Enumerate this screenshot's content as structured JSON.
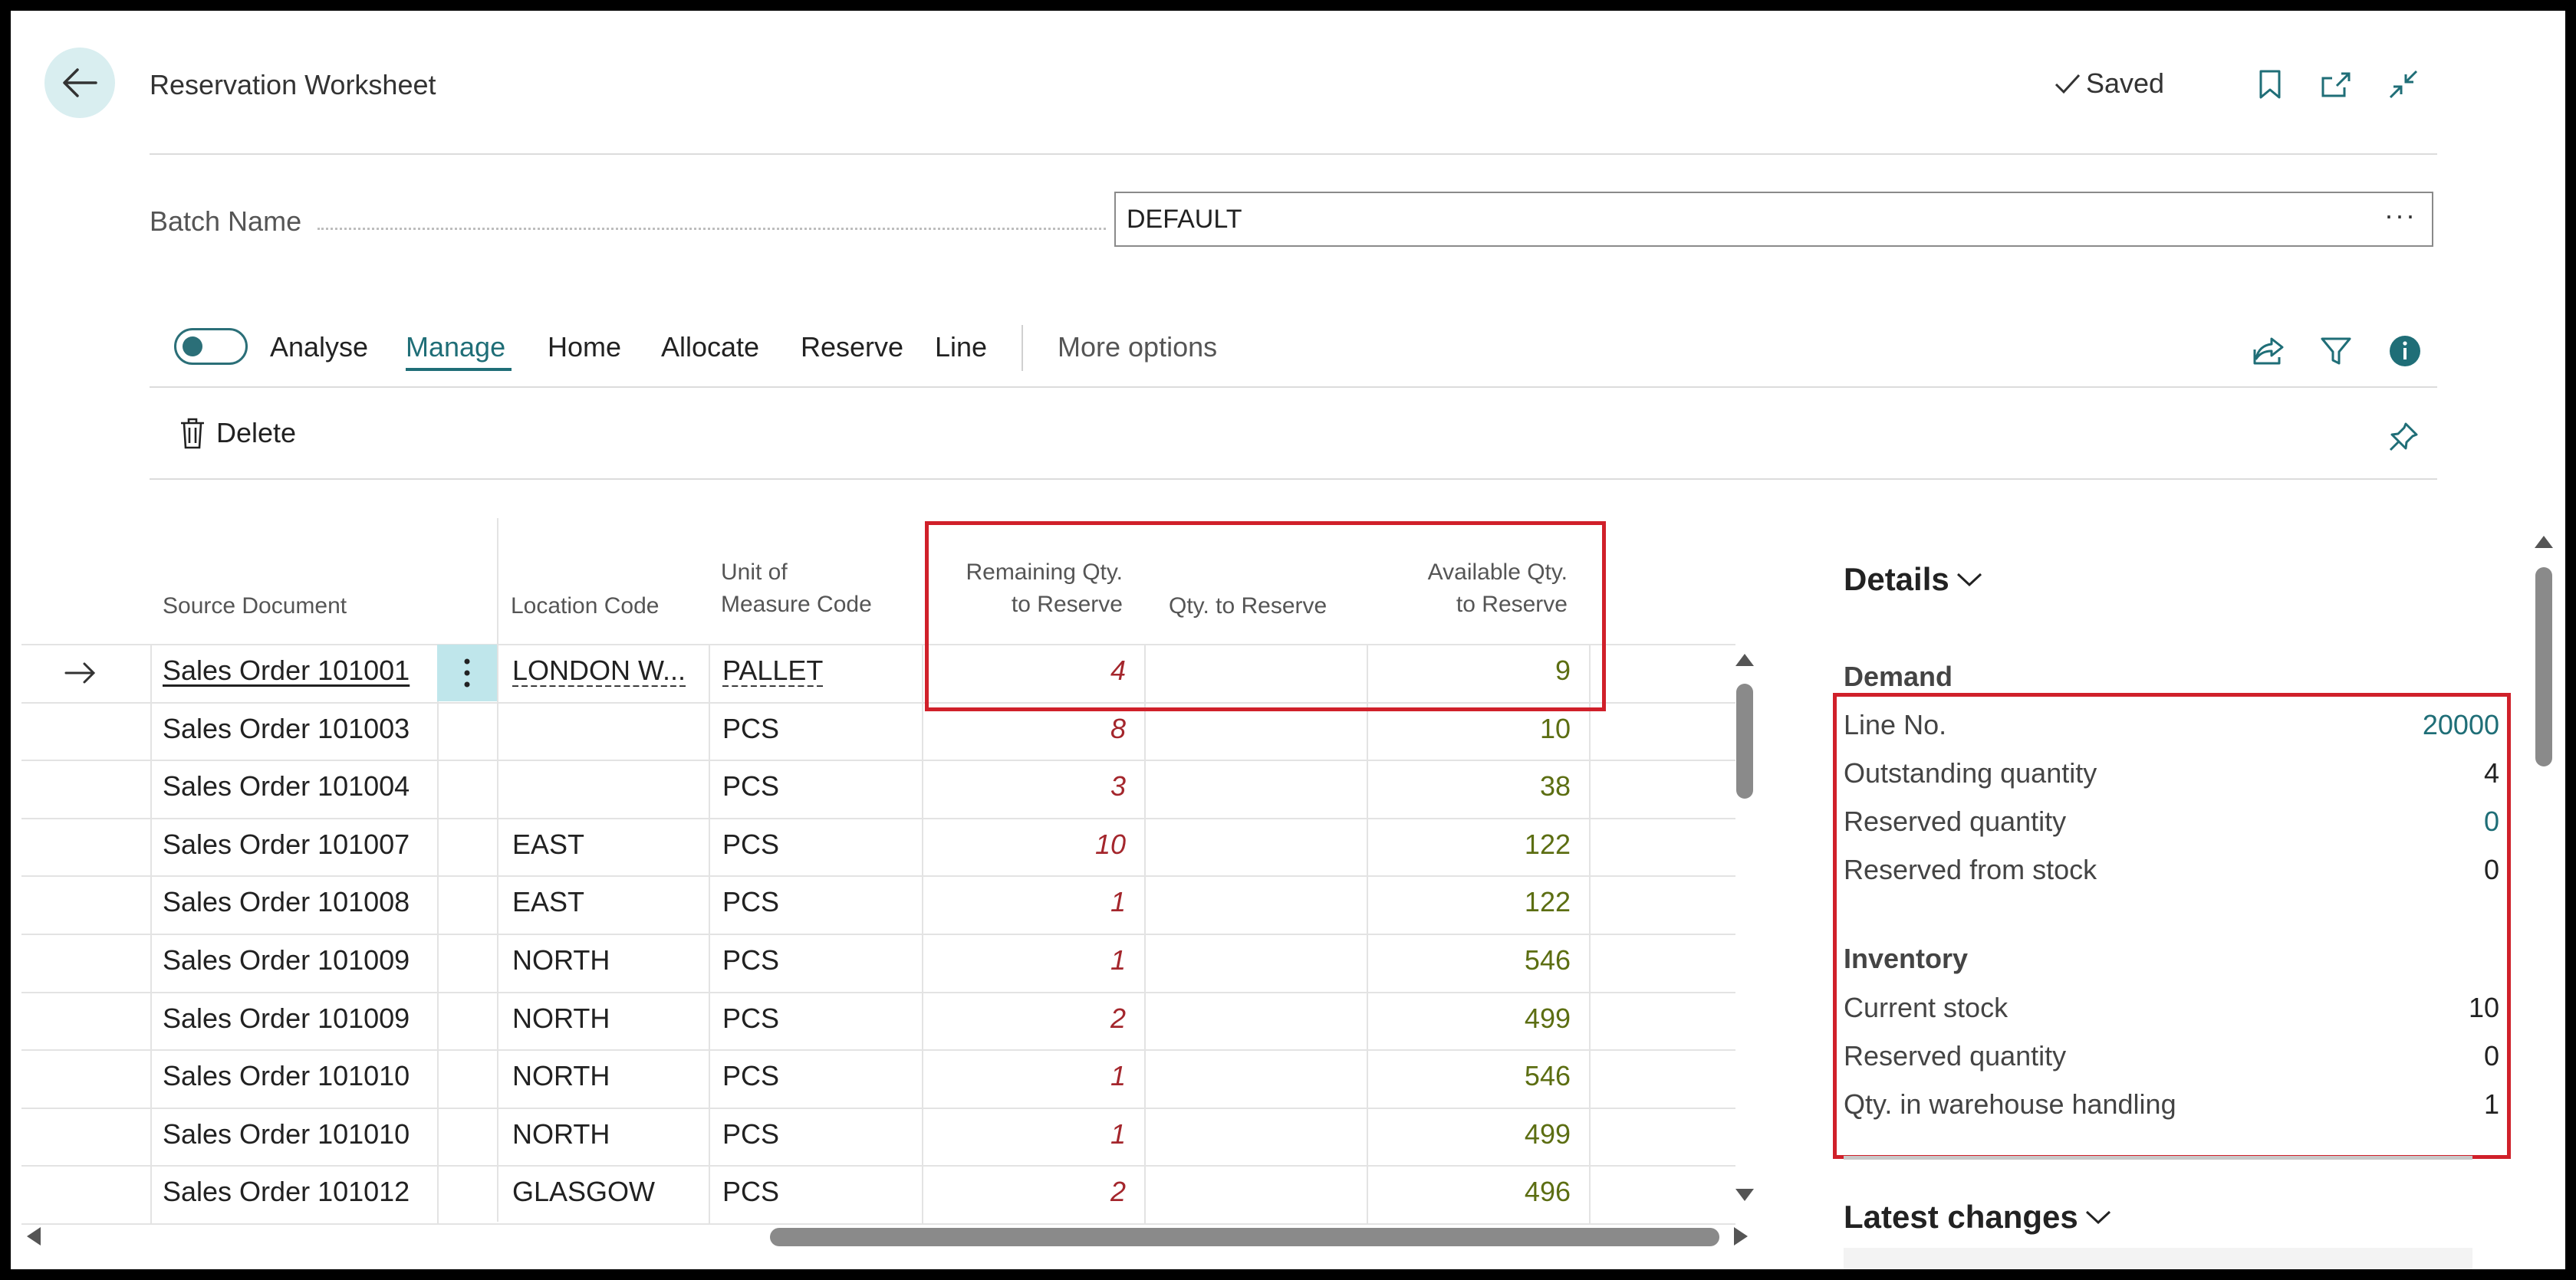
{
  "header": {
    "title": "Reservation Worksheet",
    "saved_label": "Saved",
    "icons": [
      "back-arrow-icon",
      "bookmark-icon",
      "open-new-window-icon",
      "collapse-icon"
    ]
  },
  "batch": {
    "label": "Batch Name",
    "value": "DEFAULT",
    "more": "···"
  },
  "actions": {
    "analyse_label": "Analyse",
    "analyse_on": false,
    "tabs": [
      "Manage",
      "Home",
      "Allocate",
      "Reserve",
      "Line"
    ],
    "active_tab": "Manage",
    "more_options": "More options",
    "delete_label": "Delete",
    "right_icons": [
      "share-icon",
      "filter-icon",
      "info-icon"
    ]
  },
  "grid": {
    "columns": {
      "source_document": "Source Document",
      "location_code": "Location Code",
      "unit_line1": "Unit of",
      "unit_line2": "Measure Code",
      "remaining_line1": "Remaining Qty.",
      "remaining_line2": "to Reserve",
      "qty_to_reserve": "Qty. to Reserve",
      "available_line1": "Available Qty.",
      "available_line2": "to Reserve"
    },
    "rows": [
      {
        "source": "Sales Order 101001",
        "location": "LONDON W...",
        "uom": "PALLET",
        "remaining": "4",
        "qty": "",
        "available": "9"
      },
      {
        "source": "Sales Order 101003",
        "location": "",
        "uom": "PCS",
        "remaining": "8",
        "qty": "",
        "available": "10"
      },
      {
        "source": "Sales Order 101004",
        "location": "",
        "uom": "PCS",
        "remaining": "3",
        "qty": "",
        "available": "38"
      },
      {
        "source": "Sales Order 101007",
        "location": "EAST",
        "uom": "PCS",
        "remaining": "10",
        "qty": "",
        "available": "122"
      },
      {
        "source": "Sales Order 101008",
        "location": "EAST",
        "uom": "PCS",
        "remaining": "1",
        "qty": "",
        "available": "122"
      },
      {
        "source": "Sales Order 101009",
        "location": "NORTH",
        "uom": "PCS",
        "remaining": "1",
        "qty": "",
        "available": "546"
      },
      {
        "source": "Sales Order 101009",
        "location": "NORTH",
        "uom": "PCS",
        "remaining": "2",
        "qty": "",
        "available": "499"
      },
      {
        "source": "Sales Order 101010",
        "location": "NORTH",
        "uom": "PCS",
        "remaining": "1",
        "qty": "",
        "available": "546"
      },
      {
        "source": "Sales Order 101010",
        "location": "NORTH",
        "uom": "PCS",
        "remaining": "1",
        "qty": "",
        "available": "499"
      },
      {
        "source": "Sales Order 101012",
        "location": "GLASGOW",
        "uom": "PCS",
        "remaining": "2",
        "qty": "",
        "available": "496"
      }
    ]
  },
  "factbox": {
    "title": "Details",
    "demand": {
      "title": "Demand",
      "fields": [
        {
          "label": "Line No.",
          "value": "20000",
          "link": true
        },
        {
          "label": "Outstanding quantity",
          "value": "4",
          "link": false
        },
        {
          "label": "Reserved quantity",
          "value": "0",
          "link": true
        },
        {
          "label": "Reserved from stock",
          "value": "0",
          "link": false
        }
      ]
    },
    "inventory": {
      "title": "Inventory",
      "fields": [
        {
          "label": "Current stock",
          "value": "10",
          "link": false
        },
        {
          "label": "Reserved quantity",
          "value": "0",
          "link": false
        },
        {
          "label": "Qty. in warehouse handling",
          "value": "1",
          "link": false
        }
      ]
    },
    "latest_changes": "Latest changes"
  },
  "colors": {
    "accent": "#1f6e77",
    "highlight_box": "#d0202a",
    "remaining_qty": "#a4262c",
    "available_qty": "#5c6e12"
  }
}
